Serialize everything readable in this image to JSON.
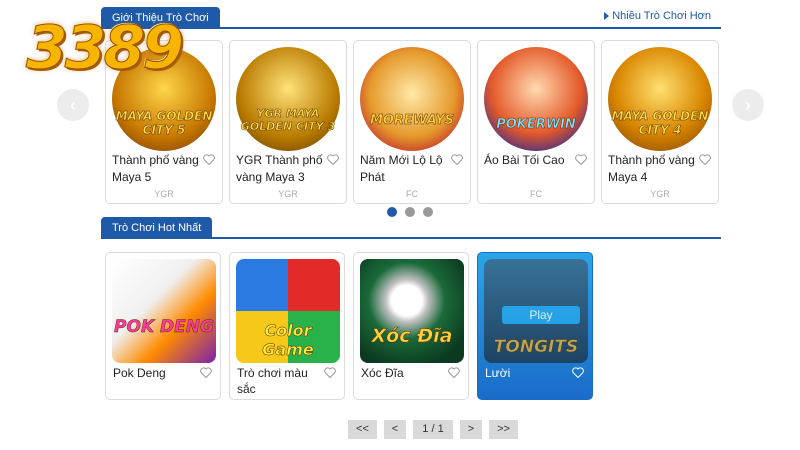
{
  "brand": {
    "logo_text": "3389"
  },
  "intro": {
    "tab_label": "Giới Thiệu Trò Chơi",
    "more_label": "Nhiều Trò Chơi Hơn",
    "prev_icon": "chevron-left-icon",
    "next_icon": "chevron-right-icon",
    "games": [
      {
        "title": "Thành phố vàng Maya 5",
        "provider": "YGR",
        "art": "MAYA GOLDEN CITY 5"
      },
      {
        "title": "YGR Thành phố vàng Maya 3",
        "provider": "YGR",
        "art": "YGR MAYA GOLDEN CITY 3"
      },
      {
        "title": "Năm Mới Lộ Lộ Phát",
        "provider": "FC",
        "art": "MOREWAYS"
      },
      {
        "title": "Áo Bài Tối Cao",
        "provider": "FC",
        "art": "POKERWIN"
      },
      {
        "title": "Thành phố vàng Maya 4",
        "provider": "YGR",
        "art": "MAYA GOLDEN CITY 4"
      }
    ],
    "dots": [
      {
        "active": true
      },
      {
        "active": false
      },
      {
        "active": false
      }
    ]
  },
  "hot": {
    "tab_label": "Trò Chơi Hot Nhất",
    "games": [
      {
        "title": "Pok Deng",
        "art": "POK DENG"
      },
      {
        "title": "Trò chơi màu sắc",
        "art": "Color Game"
      },
      {
        "title": "Xóc Đĩa",
        "art": "Xóc Đĩa"
      },
      {
        "title": "Lười",
        "art": "TONGITS",
        "play_label": "Play"
      }
    ]
  },
  "pagination": {
    "first": "<<",
    "prev": "<",
    "current": "1 / 1",
    "next": ">",
    "last": ">>"
  },
  "colors": {
    "accent": "#1e5aa8",
    "selected_card": "#1a6cc8",
    "play_button": "#26a7e8"
  }
}
